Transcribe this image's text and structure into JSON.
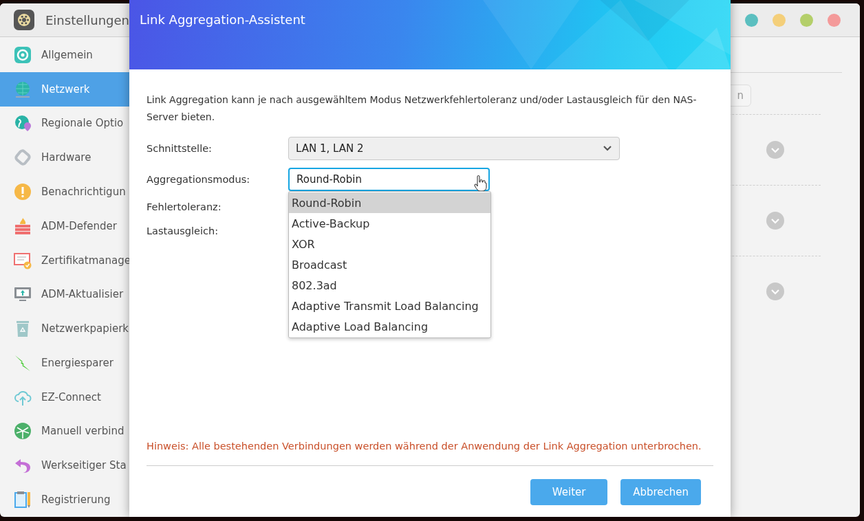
{
  "window": {
    "title": "Einstellungen"
  },
  "sidebar": {
    "items": [
      {
        "label": "Allgemein",
        "selected": false
      },
      {
        "label": "Netzwerk",
        "selected": true
      },
      {
        "label": "Regionale Optio",
        "selected": false
      },
      {
        "label": "Hardware",
        "selected": false
      },
      {
        "label": "Benachrichtigun",
        "selected": false
      },
      {
        "label": "ADM-Defender",
        "selected": false
      },
      {
        "label": "Zertifikatmanage",
        "selected": false
      },
      {
        "label": "ADM-Aktualisier",
        "selected": false
      },
      {
        "label": "Netzwerkpapierk",
        "selected": false
      },
      {
        "label": "Energiesparer",
        "selected": false
      },
      {
        "label": "EZ-Connect",
        "selected": false
      },
      {
        "label": "Manuell verbind",
        "selected": false
      },
      {
        "label": "Werkseitiger Sta",
        "selected": false
      },
      {
        "label": "Registrierung",
        "selected": false
      }
    ]
  },
  "background_panel": {
    "button_fragment": "n",
    "sections": [
      {
        "expanded": false
      },
      {
        "expanded": false
      },
      {
        "expanded": false
      }
    ]
  },
  "dialog": {
    "title": "Link Aggregation-Assistent",
    "description": "Link Aggregation kann je nach ausgewähltem Modus Netzwerkfehlertoleranz und/oder Lastausgleich für den NAS-Server bieten.",
    "fields": [
      {
        "kind": "select",
        "label": "Schnittstelle:",
        "value": "LAN 1, LAN 2",
        "disabled": true
      },
      {
        "kind": "select",
        "label": "Aggregationsmodus:",
        "value": "Round-Robin",
        "disabled": false,
        "expanded": true,
        "options": [
          {
            "label": "Round-Robin",
            "selected": true
          },
          {
            "label": "Active-Backup",
            "selected": false
          },
          {
            "label": "XOR",
            "selected": false
          },
          {
            "label": "Broadcast",
            "selected": false
          },
          {
            "label": "802.3ad",
            "selected": false
          },
          {
            "label": "Adaptive Transmit Load Balancing",
            "selected": false
          },
          {
            "label": "Adaptive Load Balancing",
            "selected": false
          }
        ]
      },
      {
        "kind": "label",
        "label": "Fehlertoleranz:"
      },
      {
        "kind": "label",
        "label": "Lastausgleich:"
      }
    ],
    "notice": "Hinweis: Alle bestehenden Verbindungen werden während der Anwendung der Link Aggregation unterbrochen.",
    "buttons": [
      "Weiter",
      "Abbrechen"
    ]
  }
}
